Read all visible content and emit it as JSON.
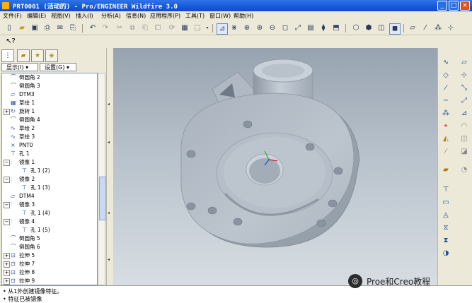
{
  "window": {
    "title": "PRT0001 (活动的) - Pro/ENGINEER Wildfire 3.0",
    "minimize": "_",
    "maximize": "□",
    "close": "×"
  },
  "menu": [
    "文件(F)",
    "编辑(E)",
    "视图(V)",
    "插入(I)",
    "分析(A)",
    "信息(N)",
    "应用程序(P)",
    "工具(T)",
    "窗口(W)",
    "帮助(H)"
  ],
  "panel": {
    "show_label": "显示(I) ▾",
    "settings_label": "设置(G) ▾"
  },
  "tree": [
    {
      "label": "倒圆角 2",
      "icon": "⌒",
      "exp": ""
    },
    {
      "label": "倒圆角 3",
      "icon": "⌒",
      "exp": ""
    },
    {
      "label": "DTM3",
      "icon": "▱",
      "exp": ""
    },
    {
      "label": "草绘 1",
      "icon": "▦",
      "exp": ""
    },
    {
      "label": "旋转 1",
      "icon": "↻",
      "exp": "+"
    },
    {
      "label": "倒圆角 4",
      "icon": "⌒",
      "exp": ""
    },
    {
      "label": "草绘 2",
      "icon": "∿",
      "exp": ""
    },
    {
      "label": "草绘 3",
      "icon": "∿",
      "exp": ""
    },
    {
      "label": "PNT0",
      "icon": "×",
      "exp": ""
    },
    {
      "label": "孔 1",
      "icon": "⊤",
      "exp": ""
    },
    {
      "label": "镜像 1",
      "icon": "⫶",
      "exp": "−"
    },
    {
      "label": "孔 1 (2)",
      "icon": "⊤",
      "exp": "",
      "indent": 2
    },
    {
      "label": "镜像 2",
      "icon": "⫶",
      "exp": "−"
    },
    {
      "label": "孔 1 (3)",
      "icon": "⊤",
      "exp": "",
      "indent": 2
    },
    {
      "label": "DTM4",
      "icon": "▱",
      "exp": ""
    },
    {
      "label": "镜像 3",
      "icon": "⫶",
      "exp": "−"
    },
    {
      "label": "孔 1 (4)",
      "icon": "⊤",
      "exp": "",
      "indent": 2
    },
    {
      "label": "镜像 4",
      "icon": "⫶",
      "exp": "−"
    },
    {
      "label": "孔 1 (5)",
      "icon": "⊤",
      "exp": "",
      "indent": 2
    },
    {
      "label": "倒圆角 5",
      "icon": "⌒",
      "exp": ""
    },
    {
      "label": "倒圆角 6",
      "icon": "⌒",
      "exp": ""
    },
    {
      "label": "拉伸 5",
      "icon": "⊡",
      "exp": "+"
    },
    {
      "label": "拉伸 7",
      "icon": "⊡",
      "exp": "+"
    },
    {
      "label": "拉伸 8",
      "icon": "⊡",
      "exp": "+"
    },
    {
      "label": "拉伸 9",
      "icon": "⊡",
      "exp": "+"
    }
  ],
  "messages": [
    "• 从1外创建镜像特征。",
    "• 特征已被镜像"
  ],
  "watermark": "Proe和Creo教程",
  "colors": {
    "titlebar": "#1659d6",
    "part": "#b4bdc7",
    "accent": "#2c2c2c"
  }
}
